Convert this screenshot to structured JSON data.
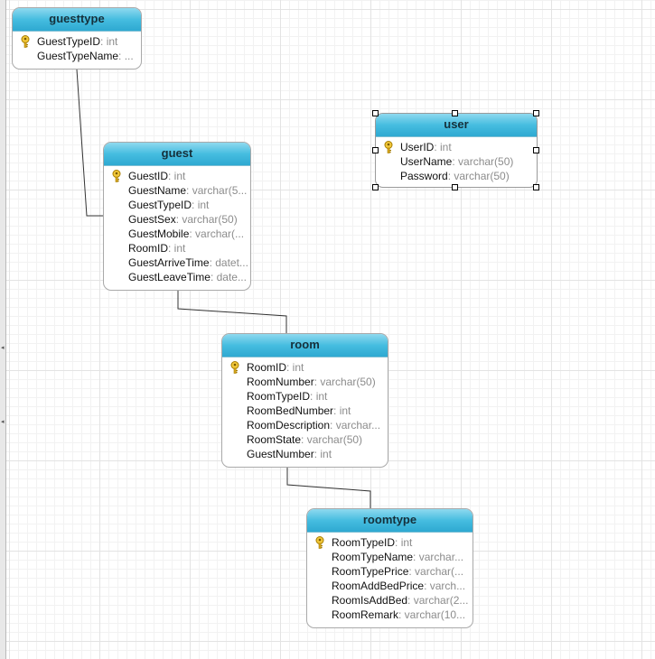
{
  "entities": [
    {
      "id": "guesttype",
      "title": "guesttype",
      "fields": [
        {
          "name": "GuestTypeID",
          "type": ": int",
          "pk": true
        },
        {
          "name": "GuestTypeName",
          "type": ": ...",
          "pk": false
        }
      ]
    },
    {
      "id": "guest",
      "title": "guest",
      "fields": [
        {
          "name": "GuestID",
          "type": ": int",
          "pk": true
        },
        {
          "name": "GuestName",
          "type": ": varchar(5...",
          "pk": false
        },
        {
          "name": "GuestTypeID",
          "type": ": int",
          "pk": false
        },
        {
          "name": "GuestSex",
          "type": ": varchar(50)",
          "pk": false
        },
        {
          "name": "GuestMobile",
          "type": ": varchar(...",
          "pk": false
        },
        {
          "name": "RoomID",
          "type": ": int",
          "pk": false
        },
        {
          "name": "GuestArriveTime",
          "type": ": datet...",
          "pk": false
        },
        {
          "name": "GuestLeaveTime",
          "type": ": date...",
          "pk": false
        }
      ]
    },
    {
      "id": "user",
      "title": "user",
      "selected": true,
      "fields": [
        {
          "name": "UserID",
          "type": ": int",
          "pk": true
        },
        {
          "name": "UserName",
          "type": ": varchar(50)",
          "pk": false
        },
        {
          "name": "Password",
          "type": ": varchar(50)",
          "pk": false
        }
      ]
    },
    {
      "id": "room",
      "title": "room",
      "fields": [
        {
          "name": "RoomID",
          "type": ": int",
          "pk": true
        },
        {
          "name": "RoomNumber",
          "type": ": varchar(50)",
          "pk": false
        },
        {
          "name": "RoomTypeID",
          "type": ": int",
          "pk": false
        },
        {
          "name": "RoomBedNumber",
          "type": ": int",
          "pk": false
        },
        {
          "name": "RoomDescription",
          "type": ": varchar...",
          "pk": false
        },
        {
          "name": "RoomState",
          "type": ": varchar(50)",
          "pk": false
        },
        {
          "name": "GuestNumber",
          "type": ": int",
          "pk": false
        }
      ]
    },
    {
      "id": "roomtype",
      "title": "roomtype",
      "fields": [
        {
          "name": "RoomTypeID",
          "type": ": int",
          "pk": true
        },
        {
          "name": "RoomTypeName",
          "type": ": varchar...",
          "pk": false
        },
        {
          "name": "RoomTypePrice",
          "type": ": varchar(...",
          "pk": false
        },
        {
          "name": "RoomAddBedPrice",
          "type": ": varch...",
          "pk": false
        },
        {
          "name": "RoomIsAddBed",
          "type": ": varchar(2...",
          "pk": false
        },
        {
          "name": "RoomRemark",
          "type": ": varchar(10...",
          "pk": false
        }
      ]
    }
  ],
  "relationships": [
    {
      "from": "guesttype",
      "to": "guest"
    },
    {
      "from": "guest",
      "to": "room"
    },
    {
      "from": "room",
      "to": "roomtype"
    }
  ],
  "colors": {
    "header": "#46bde0",
    "grid": "#e3e3e3",
    "field_type": "#8c8c8c",
    "key_icon": "#e8b923"
  },
  "icons": {
    "primary_key": "key-icon"
  }
}
